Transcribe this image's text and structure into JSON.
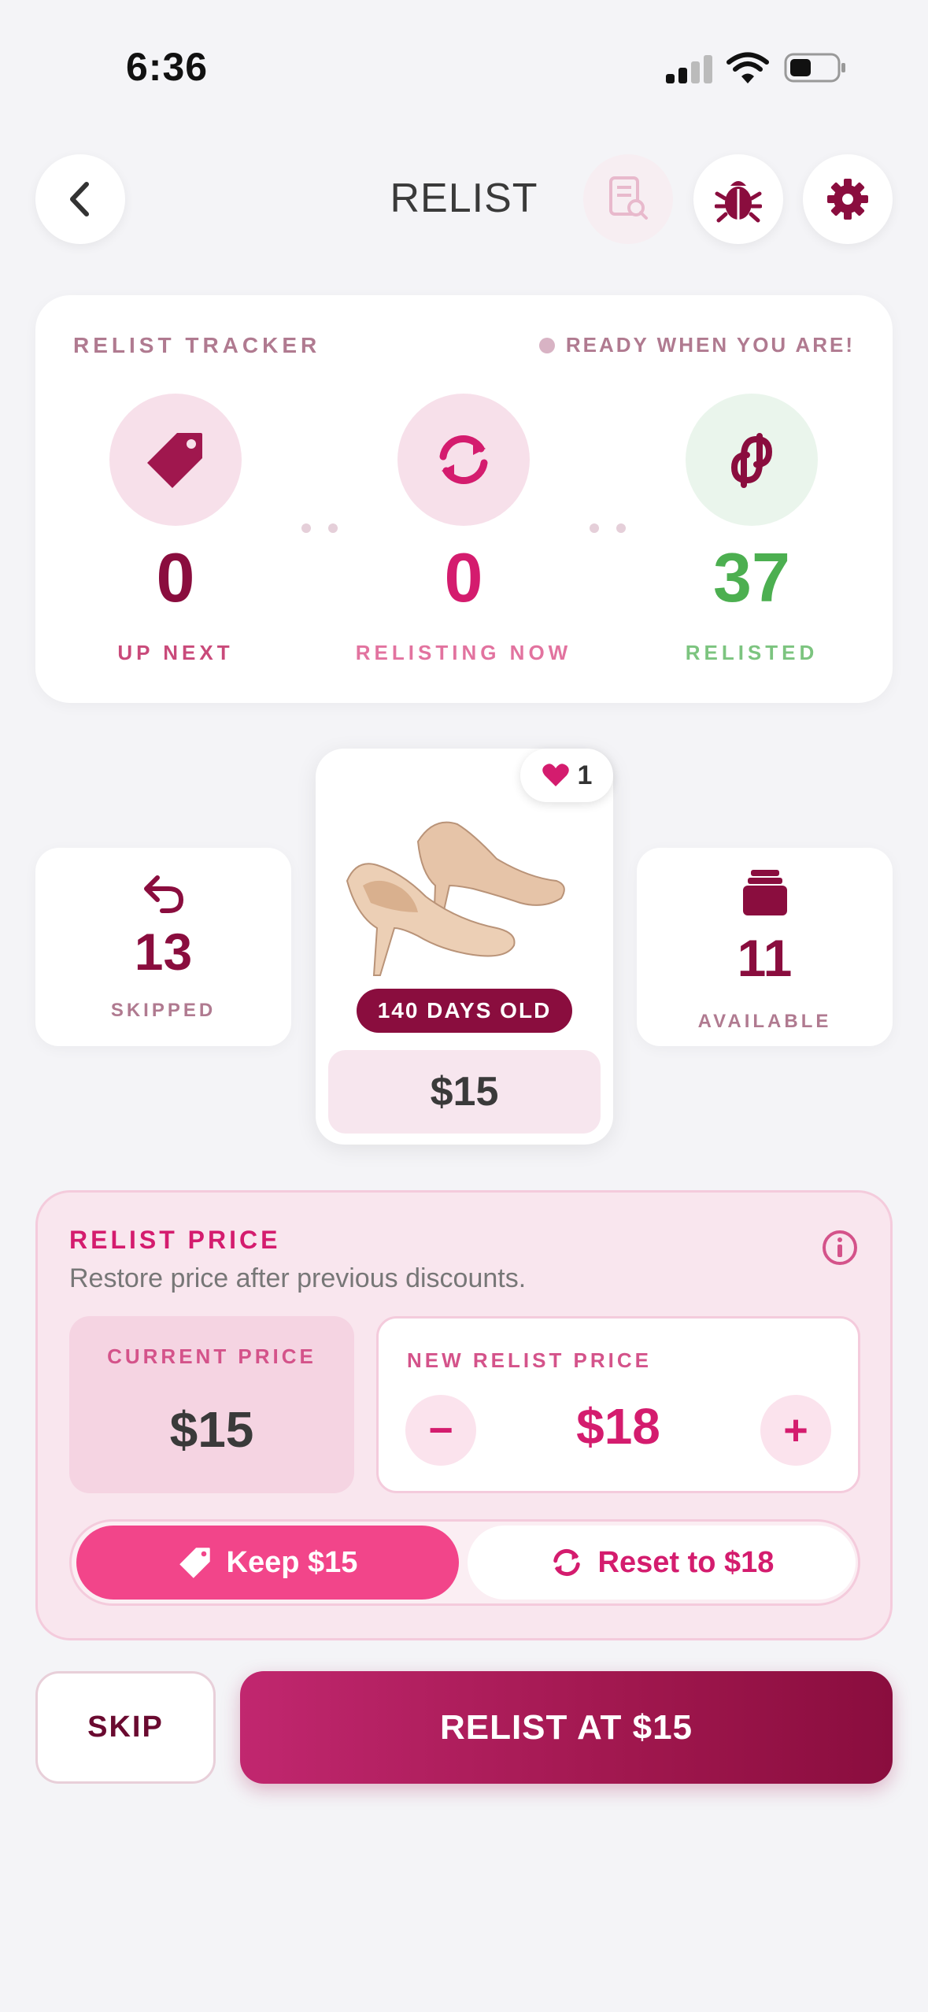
{
  "status_bar": {
    "time": "6:36"
  },
  "header": {
    "title": "RELIST"
  },
  "tracker": {
    "title": "RELIST TRACKER",
    "status": "READY WHEN YOU ARE!",
    "stages": [
      {
        "count": "0",
        "label": "UP NEXT",
        "icon": "tag-icon"
      },
      {
        "count": "0",
        "label": "RELISTING NOW",
        "icon": "refresh-icon"
      },
      {
        "count": "37",
        "label": "RELISTED",
        "icon": "poshmark-logo-icon"
      }
    ]
  },
  "skipped": {
    "count": "13",
    "label": "SKIPPED"
  },
  "available": {
    "count": "11",
    "label": "AVAILABLE"
  },
  "item": {
    "likes": "1",
    "age": "140 DAYS OLD",
    "price": "$15"
  },
  "relist_price": {
    "title": "RELIST PRICE",
    "subtitle": "Restore price after previous discounts.",
    "current_label": "CURRENT PRICE",
    "current_value": "$15",
    "new_label": "NEW RELIST PRICE",
    "new_value": "$18",
    "minus": "−",
    "plus": "+",
    "keep_label": "Keep $15",
    "reset_label": "Reset to $18"
  },
  "actions": {
    "skip": "SKIP",
    "relist": "RELIST AT $15"
  },
  "colors": {
    "accent": "#d41c6e",
    "dark_accent": "#8a0d3e",
    "success": "#4caf50",
    "background": "#f4f4f7"
  }
}
